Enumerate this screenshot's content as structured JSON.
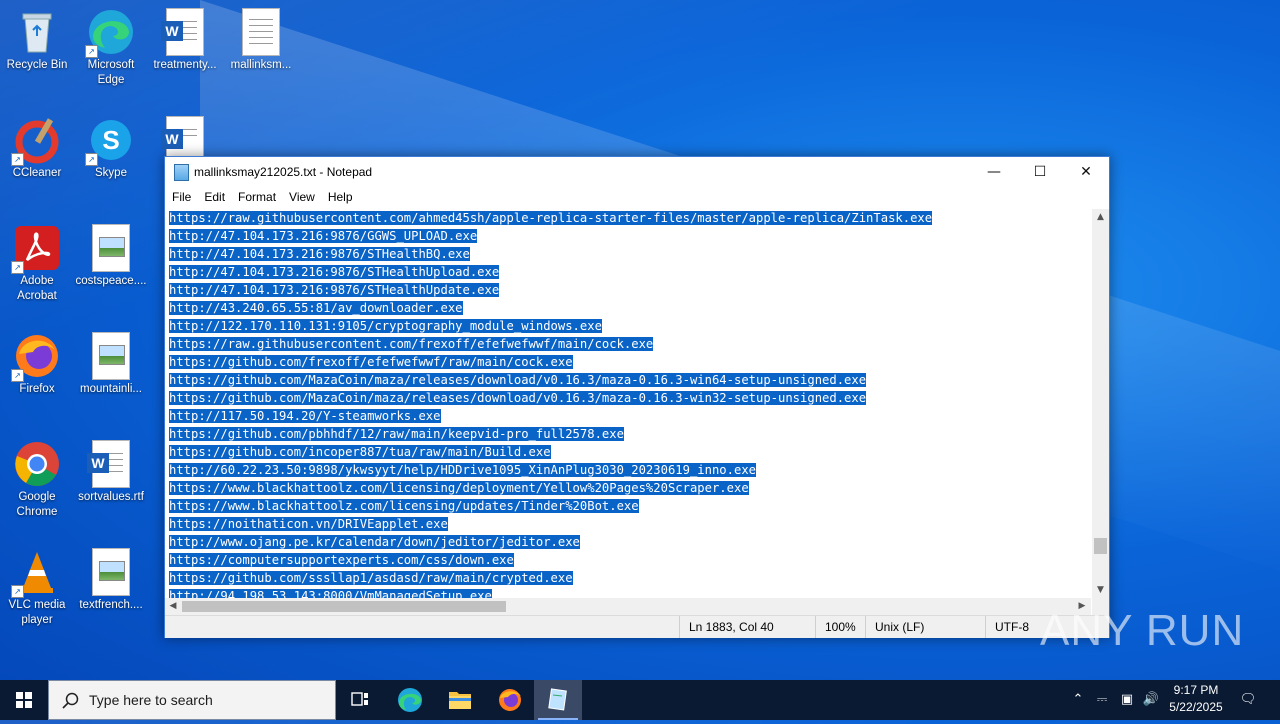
{
  "desktop": {
    "icons": [
      {
        "label": "Recycle Bin"
      },
      {
        "label": "Microsoft Edge"
      },
      {
        "label": "treatmenty..."
      },
      {
        "label": "mallinksm..."
      },
      {
        "label": "CCleaner"
      },
      {
        "label": "Skype"
      },
      {
        "label": "Adobe Acrobat"
      },
      {
        "label": "costspeace...."
      },
      {
        "label": "Firefox"
      },
      {
        "label": "mountainli..."
      },
      {
        "label": "Google Chrome"
      },
      {
        "label": "sortvalues.rtf"
      },
      {
        "label": "VLC media player"
      },
      {
        "label": "textfrench...."
      }
    ]
  },
  "notepad": {
    "title": "mallinksmay212025.txt - Notepad",
    "menu": [
      "File",
      "Edit",
      "Format",
      "View",
      "Help"
    ],
    "lines": [
      "https://raw.githubusercontent.com/ahmed45sh/apple-replica-starter-files/master/apple-replica/ZinTask.exe",
      "http://47.104.173.216:9876/GGWS_UPLOAD.exe",
      "http://47.104.173.216:9876/STHealthBQ.exe",
      "http://47.104.173.216:9876/STHealthUpload.exe",
      "http://47.104.173.216:9876/STHealthUpdate.exe",
      "http://43.240.65.55:81/av_downloader.exe",
      "http://122.170.110.131:9105/cryptography_module_windows.exe",
      "https://raw.githubusercontent.com/frexoff/efefwefwwf/main/cock.exe",
      "https://github.com/frexoff/efefwefwwf/raw/main/cock.exe",
      "https://github.com/MazaCoin/maza/releases/download/v0.16.3/maza-0.16.3-win64-setup-unsigned.exe",
      "https://github.com/MazaCoin/maza/releases/download/v0.16.3/maza-0.16.3-win32-setup-unsigned.exe",
      "http://117.50.194.20/Y-steamworks.exe",
      "https://github.com/pbhhdf/12/raw/main/keepvid-pro_full2578.exe",
      "https://github.com/incoper887/tua/raw/main/Build.exe",
      "http://60.22.23.50:9898/ykwsyyt/help/HDDrive1095_XinAnPlug3030_20230619_inno.exe",
      "https://www.blackhattoolz.com/licensing/deployment/Yellow%20Pages%20Scraper.exe",
      "https://www.blackhattoolz.com/licensing/updates/Tinder%20Bot.exe",
      "https://noithaticon.vn/DRIVEapplet.exe",
      "http://www.ojang.pe.kr/calendar/down/jeditor/jeditor.exe",
      "https://computersupportexperts.com/css/down.exe",
      "https://github.com/sssllap1/asdasd/raw/main/crypted.exe",
      "http://94.198.53.143:8000/VmManagedSetup.exe"
    ],
    "status": {
      "position": "Ln 1883, Col 40",
      "zoom": "100%",
      "line_ending": "Unix (LF)",
      "encoding": "UTF-8"
    }
  },
  "watermark": "ANY RUN",
  "taskbar": {
    "search_placeholder": "Type here to search",
    "time": "9:17 PM",
    "date": "5/22/2025"
  },
  "colors": {
    "selection": "#0a64c8",
    "taskbar": "#0b1a33",
    "desktop": "#0a64d8"
  }
}
